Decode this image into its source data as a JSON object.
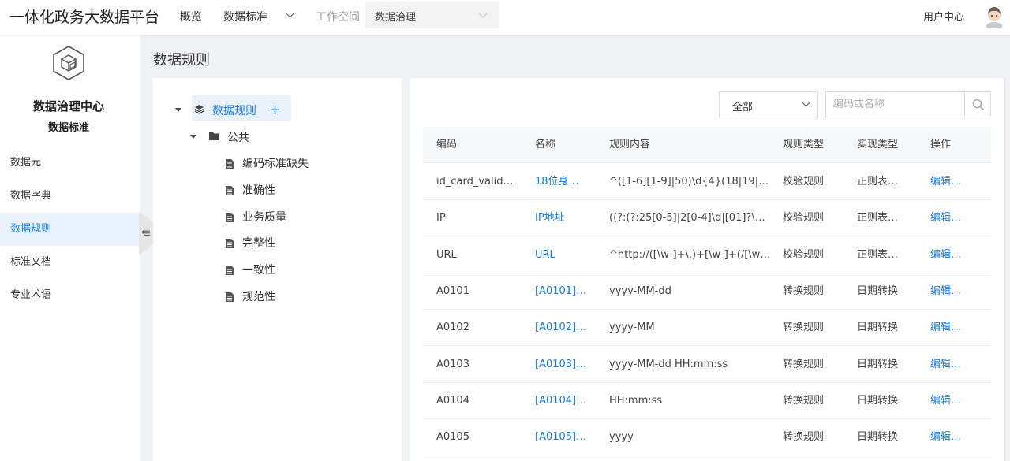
{
  "header": {
    "brand": "一体化政务大数据平台",
    "nav_overview": "概览",
    "nav_standards": "数据标准",
    "workspace_label": "工作空间",
    "workspace_value": "数据治理",
    "user_center": "用户中心"
  },
  "sidebar": {
    "title": "数据治理中心",
    "subtitle": "数据标准",
    "items": [
      {
        "label": "数据元"
      },
      {
        "label": "数据字典"
      },
      {
        "label": "数据规则"
      },
      {
        "label": "标准文档"
      },
      {
        "label": "专业术语"
      }
    ],
    "active_index": 2
  },
  "page": {
    "title": "数据规则"
  },
  "tree": {
    "root": "数据规则",
    "group": "公共",
    "leaves": [
      "编码标准缺失",
      "准确性",
      "业务质量",
      "完整性",
      "一致性",
      "规范性"
    ]
  },
  "filter": {
    "select_value": "全部",
    "search_placeholder": "编码或名称"
  },
  "table": {
    "columns": [
      "编码",
      "名称",
      "规则内容",
      "规则类型",
      "实现类型",
      "操作"
    ],
    "rows": [
      {
        "code": "id_card_valid…",
        "name": "18位身…",
        "content": "^([1-6][1-9]|50)\\d{4}(18|19|20)\\…",
        "rule_type": "校验规则",
        "impl_type": "正则表…",
        "action": "编辑…"
      },
      {
        "code": "IP",
        "name": "IP地址",
        "content": "((?:(?:25[0-5]|2[0-4]\\d|[01]?\\d…",
        "rule_type": "校验规则",
        "impl_type": "正则表…",
        "action": "编辑…"
      },
      {
        "code": "URL",
        "name": "URL",
        "content": "^http://([\\w-]+\\.)+[\\w-]+(/[\\w-./?…",
        "rule_type": "校验规则",
        "impl_type": "正则表…",
        "action": "编辑…"
      },
      {
        "code": "A0101",
        "name": "[A0101]…",
        "content": "yyyy-MM-dd",
        "rule_type": "转换规则",
        "impl_type": "日期转换",
        "action": "编辑…"
      },
      {
        "code": "A0102",
        "name": "[A0102]…",
        "content": "yyyy-MM",
        "rule_type": "转换规则",
        "impl_type": "日期转换",
        "action": "编辑…"
      },
      {
        "code": "A0103",
        "name": "[A0103]…",
        "content": "yyyy-MM-dd HH:mm:ss",
        "rule_type": "转换规则",
        "impl_type": "日期转换",
        "action": "编辑…"
      },
      {
        "code": "A0104",
        "name": "[A0104]…",
        "content": "HH:mm:ss",
        "rule_type": "转换规则",
        "impl_type": "日期转换",
        "action": "编辑…"
      },
      {
        "code": "A0105",
        "name": "[A0105]…",
        "content": "yyyy",
        "rule_type": "转换规则",
        "impl_type": "日期转换",
        "action": "编辑…"
      }
    ]
  },
  "colors": {
    "accent": "#1a7ad9",
    "active_bg": "#eaf3fc"
  }
}
